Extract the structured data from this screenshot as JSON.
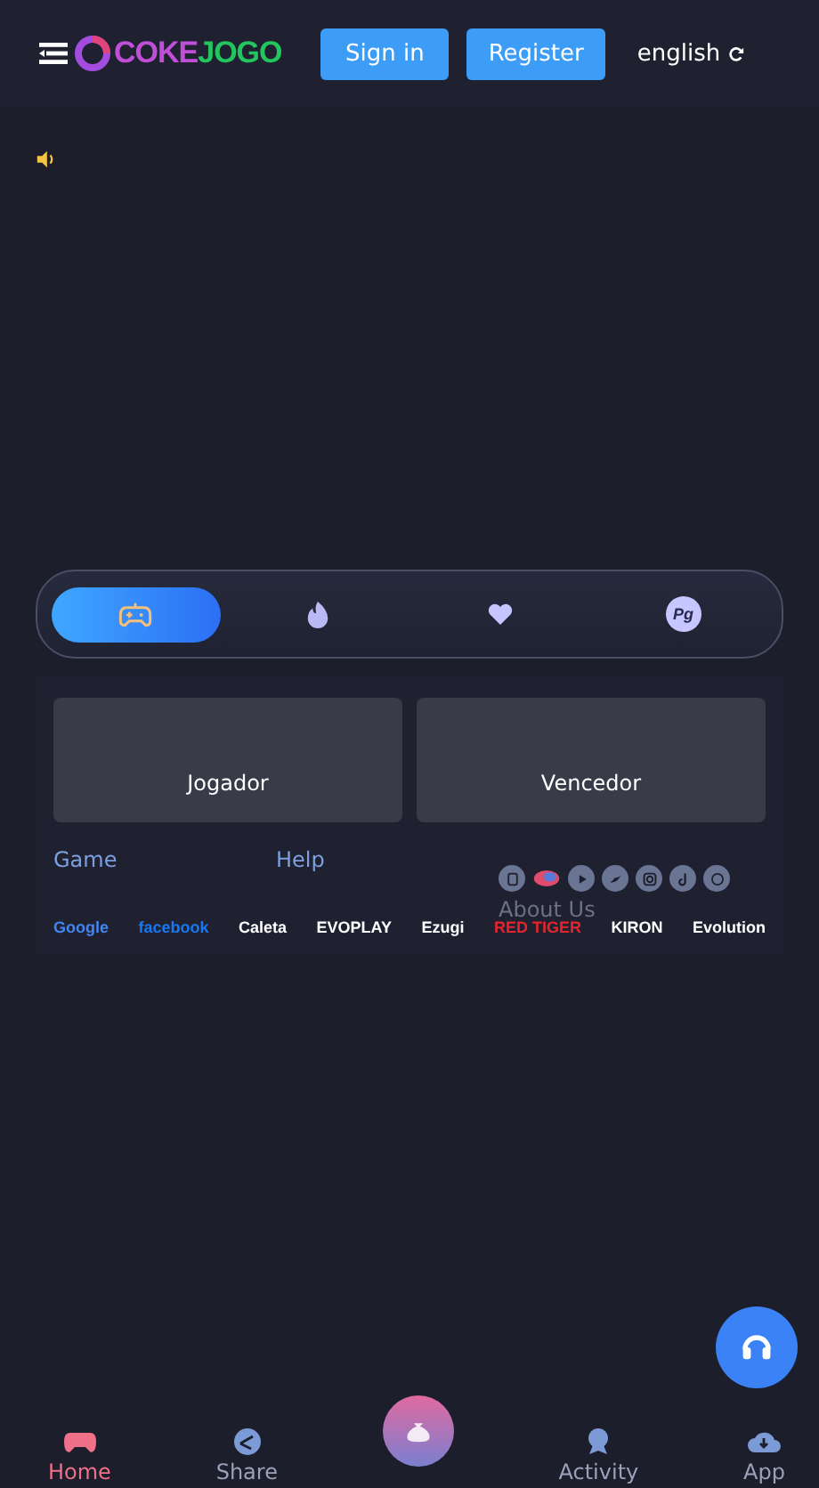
{
  "header": {
    "logo": [
      {
        "text": "COKE",
        "color": "#c04fd8"
      },
      {
        "text": "JOGO",
        "color": "#22c55e"
      }
    ],
    "buttons": [
      {
        "label": "Sign in"
      },
      {
        "label": "Register"
      }
    ],
    "language": "english"
  },
  "category_tabs": [
    {
      "kind": "gamepad",
      "selected": true
    },
    {
      "kind": "fire",
      "selected": false
    },
    {
      "kind": "heart",
      "selected": false
    },
    {
      "kind": "pg",
      "label": "Pg",
      "selected": false
    }
  ],
  "cards": [
    {
      "label": "Jogador"
    },
    {
      "label": "Vencedor"
    }
  ],
  "footer": {
    "links": [
      "Game",
      "Help"
    ],
    "socials": [
      {
        "kind": "square"
      },
      {
        "kind": "balloon"
      },
      {
        "kind": "youtube"
      },
      {
        "kind": "twitter"
      },
      {
        "kind": "instagram"
      },
      {
        "kind": "tiktok"
      },
      {
        "kind": "whatsapp"
      }
    ],
    "about": "About Us",
    "partners": [
      {
        "text": "Google",
        "color": "#4285f4"
      },
      {
        "text": "facebook",
        "color": "#1877f2"
      },
      {
        "text": "Caleta",
        "color": "#ffffff"
      },
      {
        "text": "EVOPLAY",
        "color": "#ffffff"
      },
      {
        "text": "Ezugi",
        "color": "#ffffff"
      },
      {
        "text": "RED TIGER",
        "color": "#e3262e"
      },
      {
        "text": "KIRON",
        "color": "#ffffff"
      },
      {
        "text": "Evolution",
        "color": "#ffffff"
      }
    ]
  },
  "bottom_nav": [
    {
      "kind": "home",
      "label": "Home",
      "selected": true
    },
    {
      "kind": "share",
      "label": "Share",
      "selected": false
    },
    {
      "kind": "bag",
      "selected": false
    },
    {
      "kind": "activity",
      "label": "Activity",
      "selected": false
    },
    {
      "kind": "app",
      "label": "App",
      "selected": false
    }
  ]
}
